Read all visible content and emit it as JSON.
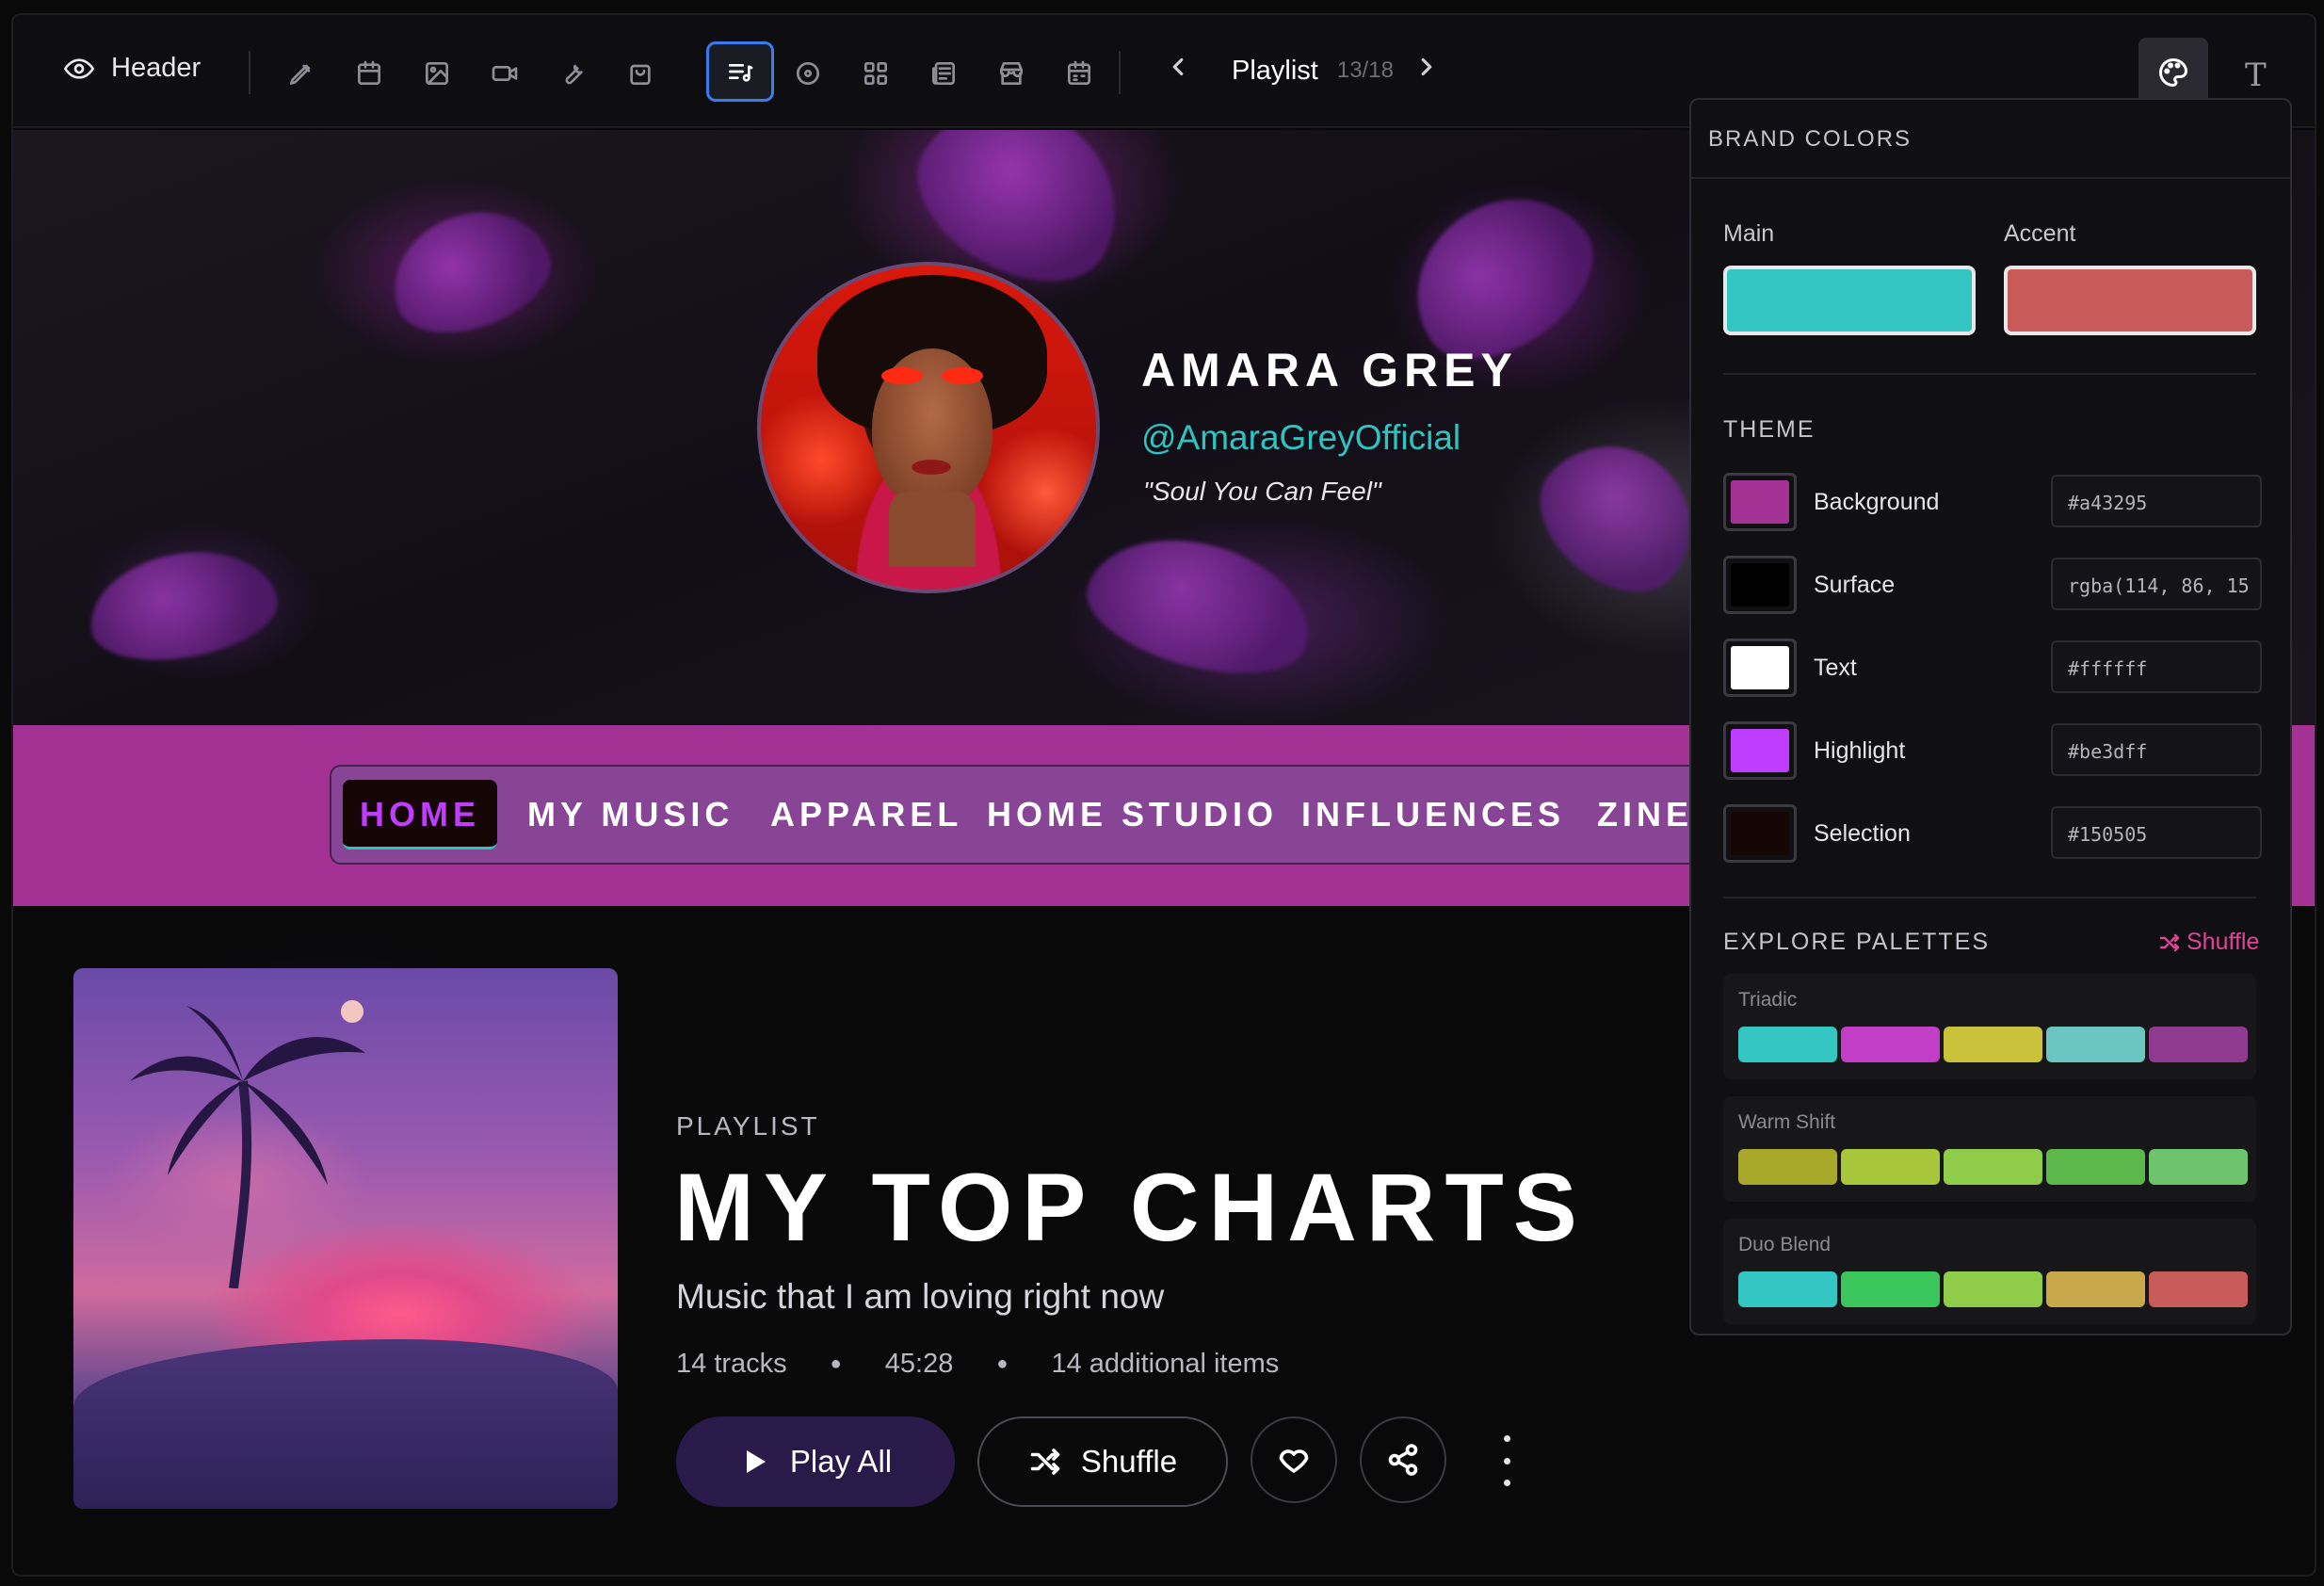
{
  "toolbar": {
    "section_label": "Header",
    "page_label": "Playlist",
    "page_count": "13/18",
    "tools": [
      "pen-icon",
      "calendar-icon",
      "image-icon",
      "video-icon",
      "wrench-icon",
      "bag-icon",
      "playlist-icon",
      "disc-icon",
      "grid-icon",
      "newspaper-icon",
      "store-icon",
      "schedule-icon"
    ],
    "active_tool": "playlist-icon",
    "type_glyph": "T"
  },
  "hero": {
    "artist_name": "AMARA GREY",
    "handle": "@AmaraGreyOfficial",
    "tagline": "\"Soul You Can Feel\""
  },
  "nav": {
    "items": [
      "HOME",
      "MY MUSIC",
      "APPAREL",
      "HOME STUDIO",
      "INFLUENCES",
      "ZINE:"
    ],
    "active": "HOME"
  },
  "playlist": {
    "kicker": "PLAYLIST",
    "title": "MY TOP CHARTS",
    "description": "Music that I am loving right now",
    "tracks": "14 tracks",
    "duration": "45:28",
    "additional": "14 additional items",
    "play_label": "Play All",
    "shuffle_label": "Shuffle"
  },
  "brand_panel": {
    "title": "BRAND COLORS",
    "main_label": "Main",
    "accent_label": "Accent",
    "main_color": "#34c6c2",
    "accent_color": "#c85a5a",
    "theme_title": "THEME",
    "theme": [
      {
        "name": "Background",
        "value": "#a43295",
        "swatch": "#a43295"
      },
      {
        "name": "Surface",
        "value": "rgba(114, 86, 15",
        "swatch": "#000000"
      },
      {
        "name": "Text",
        "value": "#ffffff",
        "swatch": "#ffffff"
      },
      {
        "name": "Highlight",
        "value": "#be3dff",
        "swatch": "#be3dff"
      },
      {
        "name": "Selection",
        "value": "#150505",
        "swatch": "#150505"
      }
    ],
    "explore_title": "EXPLORE PALETTES",
    "shuffle_label": "Shuffle",
    "palettes": [
      {
        "name": "Triadic",
        "colors": [
          "#34c6c2",
          "#c23ec6",
          "#c9c23a",
          "#6bc6c2",
          "#8e3a8e"
        ]
      },
      {
        "name": "Warm Shift",
        "colors": [
          "#a8a82a",
          "#a8c63a",
          "#8ecc4a",
          "#5cb84a",
          "#6ec46e"
        ]
      },
      {
        "name": "Duo Blend",
        "colors": [
          "#34c6c2",
          "#3ac65a",
          "#8ecc4a",
          "#c8a84a",
          "#c85a5a"
        ]
      }
    ]
  }
}
